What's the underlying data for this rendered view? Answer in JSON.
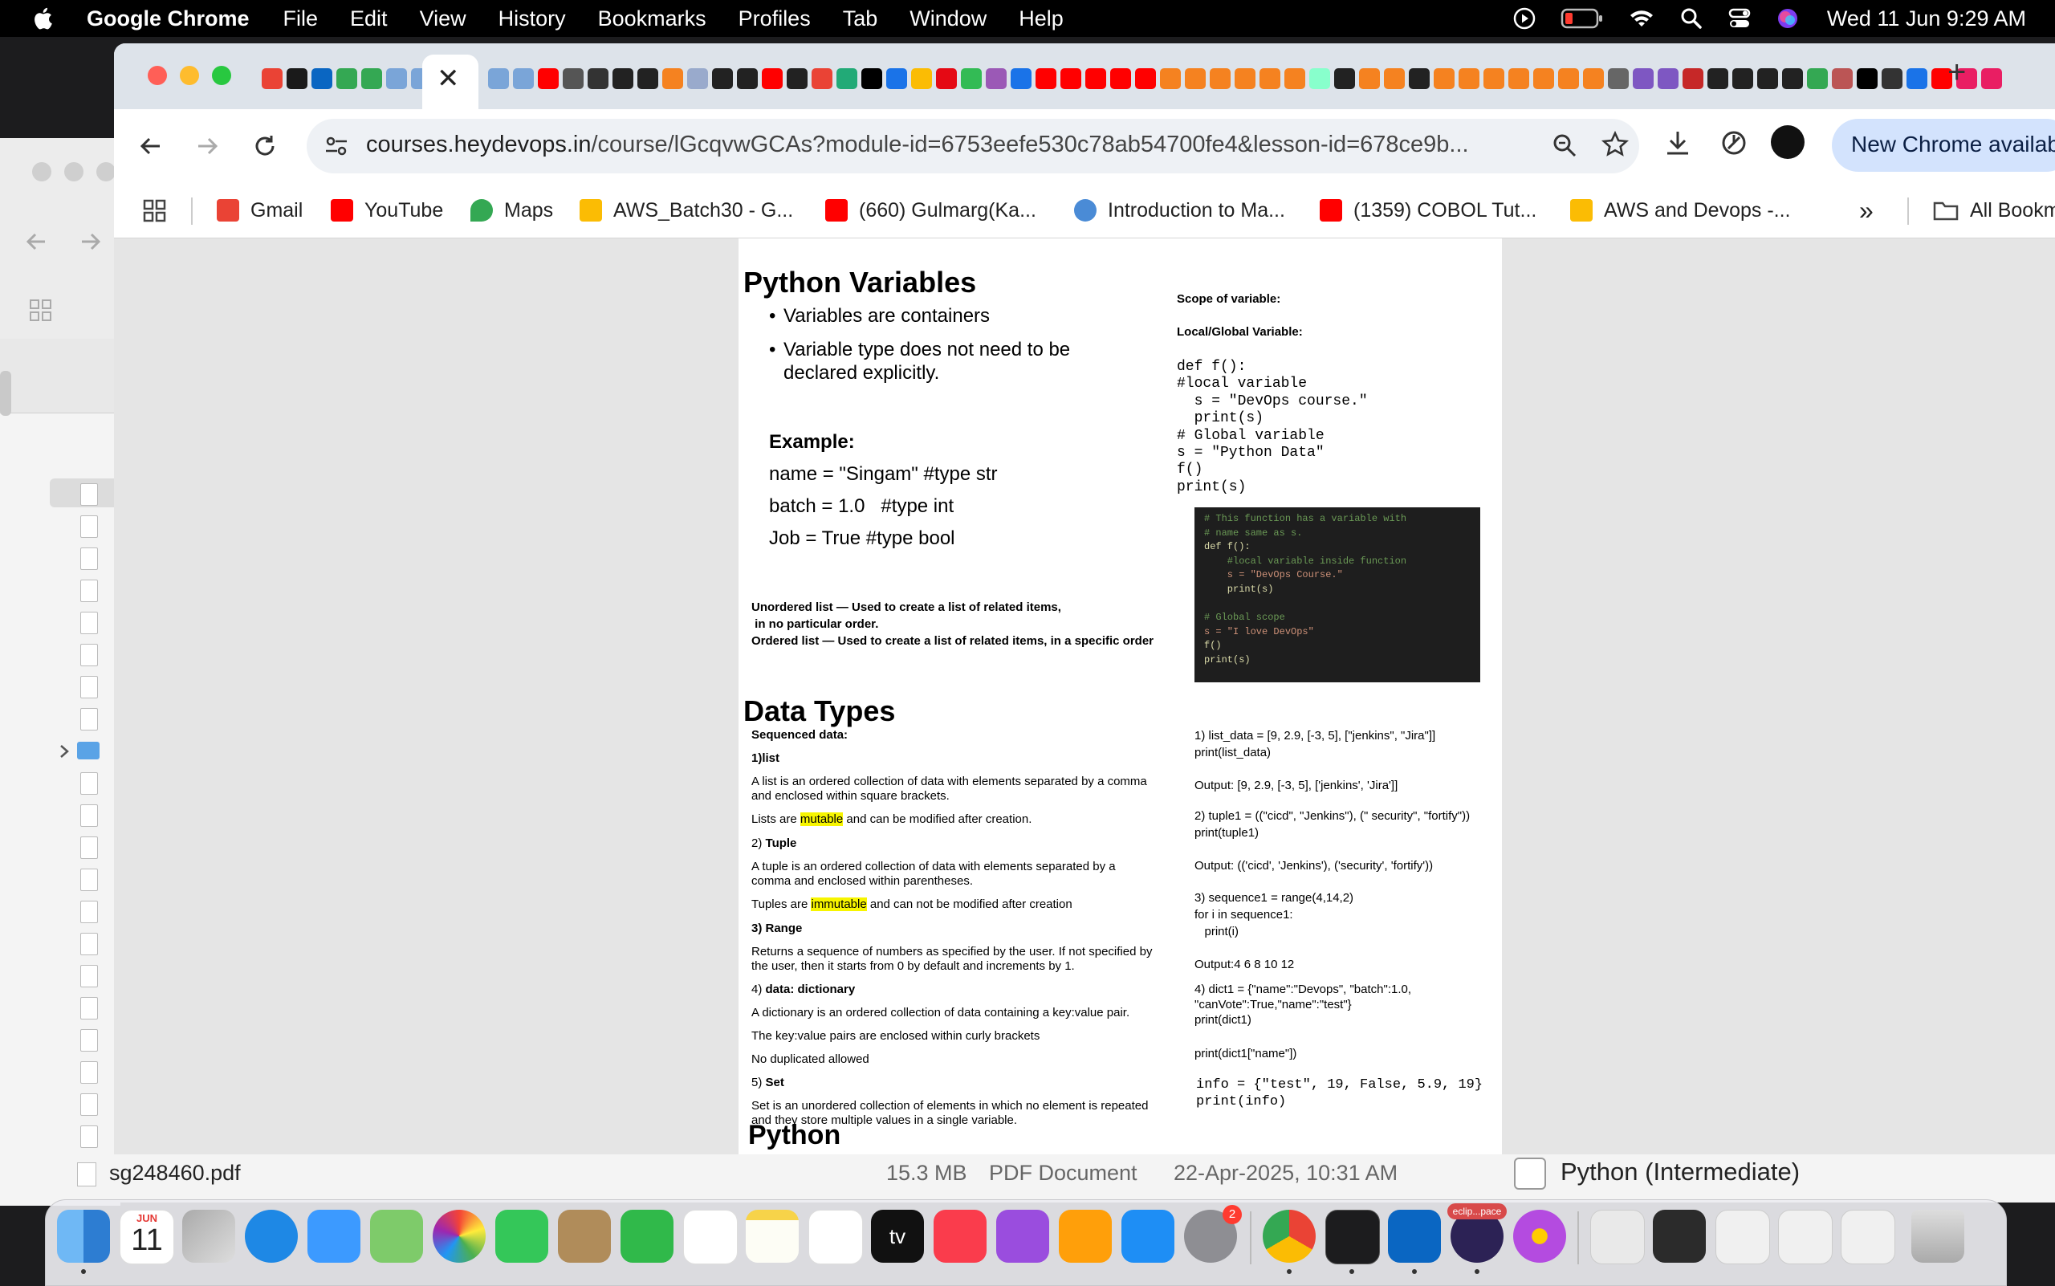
{
  "menubar": {
    "app_name": "Google Chrome",
    "menus": [
      "File",
      "Edit",
      "View",
      "History",
      "Bookmarks",
      "Profiles",
      "Tab",
      "Window",
      "Help"
    ],
    "clock": "Wed 11 Jun  9:29 AM"
  },
  "chrome": {
    "url_host": "courses.heydevops.in",
    "url_path": "/course/lGcqvwGCAs?module-id=6753eefe530c78ab54700fe4&lesson-id=678ce9b...",
    "update_label": "New Chrome availab",
    "tab_close": "✕",
    "new_tab": "+",
    "bookmarks": [
      {
        "label": "Gmail",
        "icon": "gmail-icon",
        "color": "#ea4335"
      },
      {
        "label": "YouTube",
        "icon": "youtube-icon",
        "color": "#ff0000"
      },
      {
        "label": "Maps",
        "icon": "maps-icon",
        "color": "#34a853"
      },
      {
        "label": "AWS_Batch30 - G...",
        "icon": "google-drive-icon",
        "color": "#fbbc04"
      },
      {
        "label": "(660) Gulmarg(Ka...",
        "icon": "youtube-icon",
        "color": "#ff0000"
      },
      {
        "label": "Introduction to Ma...",
        "icon": "course-icon",
        "color": "#4a8bd6"
      },
      {
        "label": "(1359) COBOL Tut...",
        "icon": "youtube-icon",
        "color": "#ff0000"
      },
      {
        "label": "AWS and Devops -...",
        "icon": "google-drive-icon",
        "color": "#fbbc04"
      }
    ],
    "more_bookmarks": "»",
    "all_bookmarks": "All Bookm"
  },
  "doc": {
    "title_vars": "Python Variables",
    "bullet1": "Variables are containers",
    "bullet2a": "Variable type does not need to be",
    "bullet2b": "declared explicitly.",
    "example_label": "Example:",
    "ex1": "name = \"Singam\" #type str",
    "ex2": "batch = 1.0   #type int",
    "ex3": "Job = True #type bool",
    "unordered1": "Unordered list — Used to create a list of related items,",
    "unordered2": " in no particular order.",
    "ordered": "Ordered list — Used to create a list of related items, in a specific order",
    "scope_title": "Scope of variable:",
    "local_global": "Local/Global Variable:",
    "scope_code": "def f():\n#local variable\n  s = \"DevOps course.\"\n  print(s)\n# Global variable\ns = \"Python Data\"\nf()\nprint(s)",
    "code_img_lines": [
      {
        "text": "# This function has a variable with",
        "color": "#6a9955"
      },
      {
        "text": "# name same as s.",
        "color": "#6a9955"
      },
      {
        "text": "def f():",
        "color": "#dcdcaa"
      },
      {
        "text": "    #local variable inside function",
        "color": "#6a9955"
      },
      {
        "text": "    s = \"DevOps Course.\"",
        "color": "#ce9178"
      },
      {
        "text": "    print(s)",
        "color": "#dcdcaa"
      },
      {
        "text": "",
        "color": "#ffffff"
      },
      {
        "text": "# Global scope",
        "color": "#6a9955"
      },
      {
        "text": "s = \"I love DevOps\"",
        "color": "#ce9178"
      },
      {
        "text": "f()",
        "color": "#dcdcaa"
      },
      {
        "text": "print(s)",
        "color": "#dcdcaa"
      }
    ],
    "title_types": "Data Types",
    "seq_data": "Sequenced data:",
    "list_h": "1)list",
    "list_d1": "A list is an ordered collection of data with elements separated by a comma",
    "list_d2": "and enclosed within square brackets.",
    "list_m_pre": "Lists are ",
    "list_m_hl": "mutable",
    "list_m_post": " and can be modified after creation.",
    "tuple_h_num": "2) ",
    "tuple_h": "Tuple",
    "tuple_d1": "A tuple is an ordered collection of data with elements separated by a",
    "tuple_d2": "comma and enclosed within parentheses.",
    "tuple_m_pre": "Tuples are ",
    "tuple_m_hl": "immutable",
    "tuple_m_post": " and can not be modified after creation",
    "range_h": "3) Range",
    "range_d1": "Returns a sequence of numbers as specified by the user. If not specified by",
    "range_d2": "the user, then it starts from 0 by default and increments by 1.",
    "dict_h_num": "4) ",
    "dict_h": "data: dictionary",
    "dict_d1": "A dictionary is an ordered collection of data containing a key:value pair.",
    "dict_d2": "The key:value pairs are enclosed within curly brackets",
    "dict_d3": "No duplicated allowed",
    "set_h_num": "5) ",
    "set_h": "Set",
    "set_d1": "Set is an unordered collection of elements in which no element is repeated",
    "set_d2": "and they store multiple values in a single variable.",
    "r1a": "1) list_data = [9, 2.9, [-3, 5], [\"jenkins\", \"Jira\"]]",
    "r1b": "print(list_data)",
    "r1o": "Output: [9, 2.9, [-3, 5], ['jenkins', 'Jira']]",
    "r2a": "2) tuple1 = ((\"cicd\", \"Jenkins\"), (\" security\", \"fortify\"))",
    "r2b": "print(tuple1)",
    "r2o": "Output: (('cicd', 'Jenkins'), ('security', 'fortify'))",
    "r3a": "3) sequence1 = range(4,14,2)",
    "r3b": "for i in sequence1:",
    "r3c": "   print(i)",
    "r3o": "Output:4 6 8 10 12",
    "r4a": "4) dict1 = {\"name\":\"Devops\", \"batch\":1.0,",
    "r4b": "\"canVote\":True,\"name\":\"test\"}",
    "r4c": "print(dict1)",
    "r4d": "print(dict1[\"name\"])",
    "r5": "info = {\"test\", 19, False, 5.9, 19}\nprint(info)",
    "title_python": "Python"
  },
  "finder": {
    "file_name": "sg248460.pdf",
    "file_size": "15.3 MB",
    "file_kind": "PDF Document",
    "file_date": "22-Apr-2025, 10:31 AM",
    "course_label": "Python (Intermediate)"
  },
  "dock": {
    "calendar_month": "JUN",
    "calendar_day": "11",
    "settings_badge": "2",
    "eclipse_label": "eclip...pace",
    "tv_label": "tv"
  }
}
